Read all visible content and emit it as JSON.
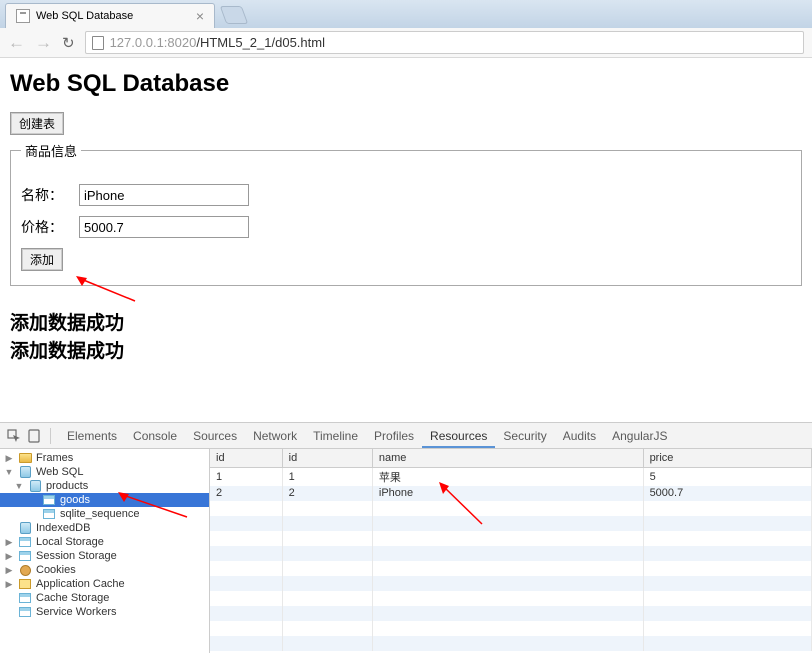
{
  "browser": {
    "tab_title": "Web SQL Database",
    "url_host": "127.0.0.1",
    "url_port": ":8020",
    "url_path": "/HTML5_2_1/d05.html"
  },
  "page": {
    "heading": "Web SQL Database",
    "create_table_btn": "创建表",
    "fieldset_legend": "商品信息",
    "name_label": "名称：",
    "name_value": "iPhone",
    "price_label": "价格：",
    "price_value": "5000.7",
    "add_btn": "添加",
    "success_msg_1": "添加数据成功",
    "success_msg_2": "添加数据成功"
  },
  "devtools": {
    "tabs": [
      "Elements",
      "Console",
      "Sources",
      "Network",
      "Timeline",
      "Profiles",
      "Resources",
      "Security",
      "Audits",
      "AngularJS"
    ],
    "active_tab_index": 6,
    "tree": [
      {
        "label": "Frames",
        "icon": "folder",
        "indent": 0,
        "twisty": "▶"
      },
      {
        "label": "Web SQL",
        "icon": "db",
        "indent": 0,
        "twisty": "▼"
      },
      {
        "label": "products",
        "icon": "db",
        "indent": 1,
        "twisty": "▼"
      },
      {
        "label": "goods",
        "icon": "tbl",
        "indent": 2,
        "twisty": "",
        "selected": true
      },
      {
        "label": "sqlite_sequence",
        "icon": "tbl",
        "indent": 2,
        "twisty": ""
      },
      {
        "label": "IndexedDB",
        "icon": "db",
        "indent": 0,
        "twisty": ""
      },
      {
        "label": "Local Storage",
        "icon": "tbl",
        "indent": 0,
        "twisty": "▶"
      },
      {
        "label": "Session Storage",
        "icon": "tbl",
        "indent": 0,
        "twisty": "▶"
      },
      {
        "label": "Cookies",
        "icon": "cookie",
        "indent": 0,
        "twisty": "▶"
      },
      {
        "label": "Application Cache",
        "icon": "cache",
        "indent": 0,
        "twisty": "▶"
      },
      {
        "label": "Cache Storage",
        "icon": "tbl",
        "indent": 0,
        "twisty": ""
      },
      {
        "label": "Service Workers",
        "icon": "tbl",
        "indent": 0,
        "twisty": ""
      }
    ],
    "table": {
      "columns": [
        "id",
        "id",
        "name",
        "price"
      ],
      "rows": [
        [
          "1",
          "1",
          "苹果",
          "5"
        ],
        [
          "2",
          "2",
          "iPhone",
          "5000.7"
        ]
      ]
    }
  }
}
